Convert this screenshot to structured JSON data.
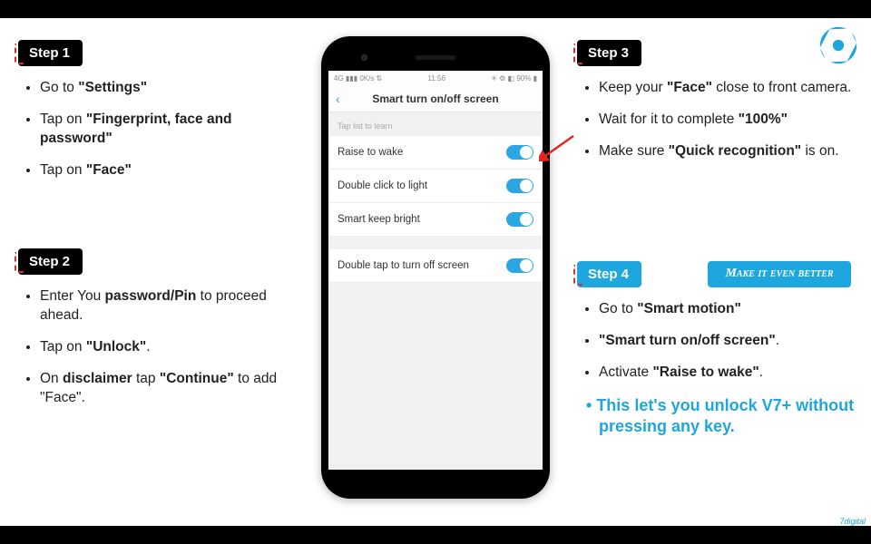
{
  "steps": {
    "s1": {
      "label": "Step 1",
      "items": [
        "Go to <b>\"Settings\"</b>",
        "Tap on <b>\"Fingerprint, face and password\"</b>",
        "Tap on <b>\"Face\"</b>"
      ]
    },
    "s2": {
      "label": "Step 2",
      "items": [
        "Enter You <b>password/Pin</b> to proceed ahead.",
        "Tap on <b>\"Unlock\"</b>.",
        "On <b>disclaimer</b> tap <b>\"Continue\"</b> to add \"Face\"."
      ]
    },
    "s3": {
      "label": "Step 3",
      "items": [
        "Keep your <b>\"Face\"</b> close to front camera.",
        "Wait for it to complete <b>\"100%\"</b>",
        "Make sure <b>\"Quick recognition\"</b> is on."
      ]
    },
    "s4": {
      "label": "Step 4",
      "items": [
        "Go to <b>\"Smart motion\"</b>",
        "<b>\"Smart turn on/off screen\"</b>.",
        "Activate <b>\"Raise to wake\"</b>."
      ],
      "tip": "This let's you unlock V7+ without pressing any key."
    }
  },
  "callout": "Make it even better",
  "phone": {
    "status_left": "4G ▮▮▮ 0K/s ⇅",
    "status_time": "11:56",
    "status_right": "✳ ⚙ ◧ 90% ▮",
    "title": "Smart turn on/off screen",
    "section": "Tap list to learn",
    "rows": {
      "r1": "Raise to wake",
      "r2": "Double click to light",
      "r3": "Smart keep bright",
      "r4": "Double tap to turn off screen"
    }
  },
  "footer": "7digital"
}
